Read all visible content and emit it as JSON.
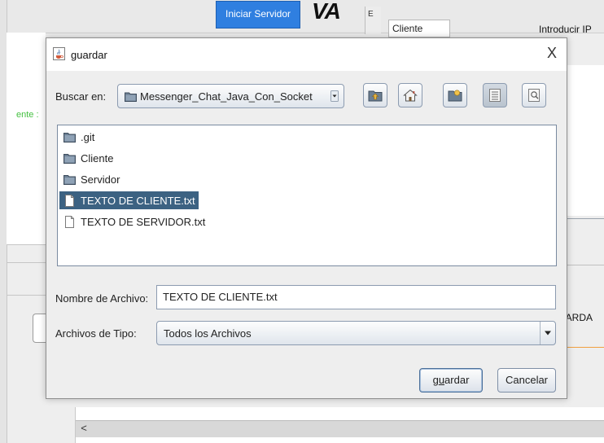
{
  "background": {
    "start_button": "Iniciar Servidor",
    "logo_text": "VA",
    "fragment_e": "E",
    "cliente_field": "Cliente",
    "ip_label": "Introducir IP",
    "left_fragment": "ente :",
    "right_button_fragment": "UARDA",
    "scroll_left": "<"
  },
  "dialog": {
    "title": "guardar",
    "close_glyph": "X",
    "look_in_label": "Buscar en:",
    "look_in_value": "Messenger_Chat_Java_Con_Socket",
    "toolbar_icons": [
      "up-folder-icon",
      "home-icon",
      "new-folder-icon",
      "list-view-icon",
      "details-view-icon"
    ],
    "files": [
      {
        "name": ".git",
        "type": "folder"
      },
      {
        "name": "Cliente",
        "type": "folder"
      },
      {
        "name": "Servidor",
        "type": "folder"
      },
      {
        "name": "TEXTO DE CLIENTE.txt",
        "type": "file",
        "selected": true
      },
      {
        "name": "TEXTO DE SERVIDOR.txt",
        "type": "file"
      }
    ],
    "file_name_label": "Nombre de Archivo:",
    "file_name_value": "TEXTO DE CLIENTE.txt",
    "file_type_label": "Archivos de Tipo:",
    "file_type_value": "Todos los Archivos",
    "save_button": {
      "pre": "g",
      "underlined": "u",
      "post": "ardar"
    },
    "cancel_button": "Cancelar"
  },
  "colors": {
    "selection": "#3c6282",
    "start_button": "#2f7fe0",
    "green_label": "#44c040"
  }
}
